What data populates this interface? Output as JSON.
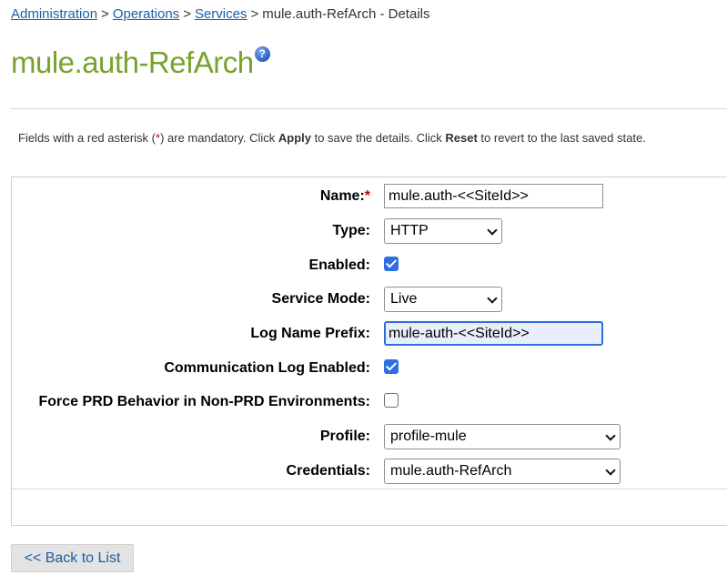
{
  "breadcrumb": {
    "items": [
      "Administration",
      "Operations",
      "Services"
    ],
    "current": "mule.auth-RefArch - Details",
    "separator": ">"
  },
  "page": {
    "title": "mule.auth-RefArch",
    "help_icon_glyph": "?"
  },
  "note": {
    "prefix": "Fields with a red asterisk (",
    "asterisk": "*",
    "middle1": ") are mandatory. Click ",
    "apply": "Apply",
    "middle2": " to save the details. Click ",
    "reset": "Reset",
    "suffix": " to revert to the last saved state."
  },
  "form": {
    "name": {
      "label": "Name:",
      "required_mark": "*",
      "value": "mule.auth-<<SiteId>>"
    },
    "type": {
      "label": "Type:",
      "value": "HTTP"
    },
    "enabled": {
      "label": "Enabled:",
      "checked": true
    },
    "service_mode": {
      "label": "Service Mode:",
      "value": "Live"
    },
    "log_name_prefix": {
      "label": "Log Name Prefix:",
      "value": "mule-auth-<<SiteId>>"
    },
    "communication_log_enabled": {
      "label": "Communication Log Enabled:",
      "checked": true
    },
    "force_prd": {
      "label": "Force PRD Behavior in Non-PRD Environments:",
      "checked": false
    },
    "profile": {
      "label": "Profile:",
      "value": "profile-mule"
    },
    "credentials": {
      "label": "Credentials:",
      "value": "mule.auth-RefArch"
    }
  },
  "actions": {
    "back_label": "<< Back to List"
  },
  "colors": {
    "title": "#78a22f",
    "link": "#1a5ea8",
    "required": "#cc0000",
    "checkbox": "#2f6fe3",
    "focus": "#2d6fdf"
  }
}
